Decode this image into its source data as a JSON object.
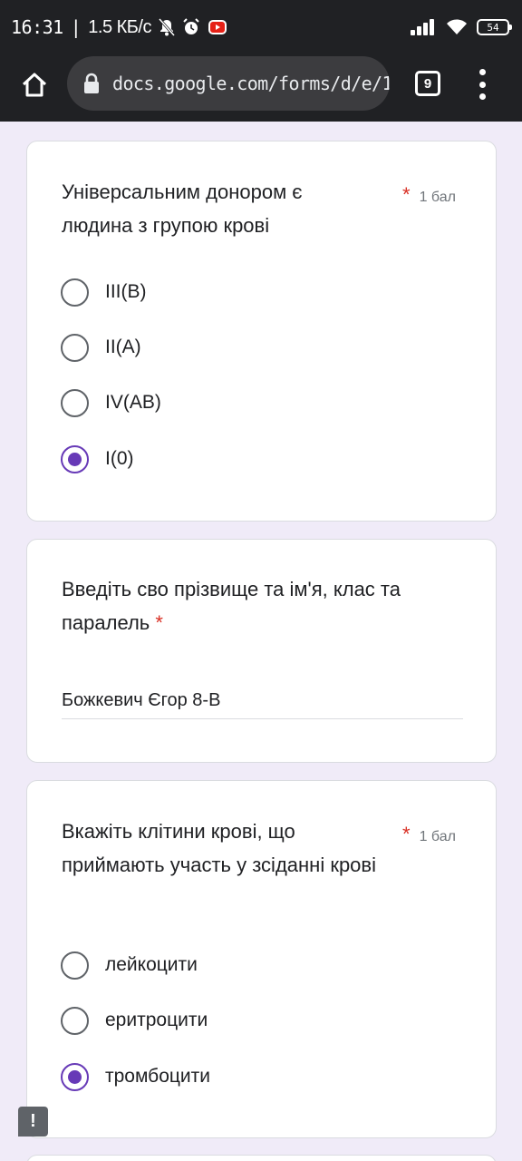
{
  "status_bar": {
    "time": "16:31",
    "separator": "|",
    "speed": "1.5 КБ/с",
    "battery": "54",
    "icons": [
      "mute-icon",
      "alarm-icon",
      "youtube-icon",
      "signal-icon",
      "wifi-icon",
      "battery-icon"
    ]
  },
  "browser": {
    "url": "docs.google.com/forms/d/e/1",
    "tab_count": "9",
    "icons": [
      "home-icon",
      "lock-icon",
      "more-vert-icon"
    ]
  },
  "questions": [
    {
      "title": "Універсальним донором є людина з групою крові",
      "required_mark": "*",
      "points": "1 бал",
      "options": [
        {
          "label": "III(B)",
          "checked": false
        },
        {
          "label": "II(A)",
          "checked": false
        },
        {
          "label": "IV(AB)",
          "checked": false
        },
        {
          "label": "I(0)",
          "checked": true
        }
      ]
    },
    {
      "title": "Введіть сво прізвище та ім'я, клас та паралель",
      "required_mark": "*",
      "answer": "Божкевич Єгор 8-В"
    },
    {
      "title": "Вкажіть клітини крові, що приймають участь у зсіданні крові",
      "required_mark": "*",
      "points": "1 бал",
      "options": [
        {
          "label": "лейкоцити",
          "checked": false
        },
        {
          "label": "еритроцити",
          "checked": false
        },
        {
          "label": "тромбоцити",
          "checked": true
        }
      ]
    }
  ],
  "report_button": "!",
  "colors": {
    "accent": "#673ab7",
    "required": "#d93025",
    "page_background": "#f0ebf8",
    "chrome": "#202124"
  }
}
